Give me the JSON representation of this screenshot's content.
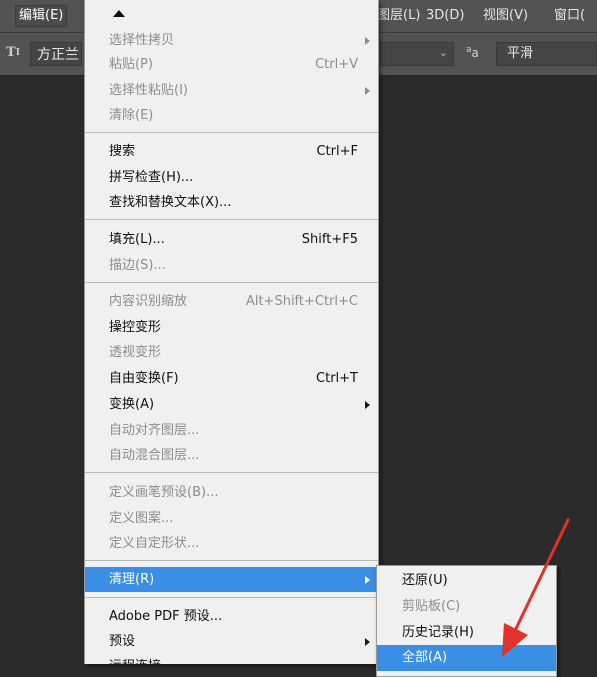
{
  "menubar": {
    "items": [
      {
        "label": "编辑(E)",
        "active": true
      },
      {
        "label": "图层(L)"
      },
      {
        "label": "3D(D)"
      },
      {
        "label": "视图(V)"
      },
      {
        "label": "窗口("
      }
    ]
  },
  "options_bar": {
    "tool_icon": "text-tool-icon",
    "font_family": "方正兰",
    "size_value": "",
    "antialias_icon": "aa-icon",
    "antialias_mode": "平滑"
  },
  "edit_menu": {
    "scroll_up_icon": "scroll-up-arrow-icon",
    "groups": [
      [
        {
          "label": "选择性拷贝",
          "shortcut": "",
          "disabled": true,
          "submenu": true
        },
        {
          "label": "粘贴(P)",
          "shortcut": "Ctrl+V",
          "disabled": true
        },
        {
          "label": "选择性粘贴(I)",
          "shortcut": "",
          "disabled": true,
          "submenu": true
        },
        {
          "label": "清除(E)",
          "shortcut": "",
          "disabled": true
        }
      ],
      [
        {
          "label": "搜索",
          "shortcut": "Ctrl+F"
        },
        {
          "label": "拼写检查(H)...",
          "shortcut": ""
        },
        {
          "label": "查找和替换文本(X)...",
          "shortcut": ""
        }
      ],
      [
        {
          "label": "填充(L)...",
          "shortcut": "Shift+F5"
        },
        {
          "label": "描边(S)...",
          "shortcut": "",
          "disabled": true
        }
      ],
      [
        {
          "label": "内容识别缩放",
          "shortcut": "Alt+Shift+Ctrl+C",
          "disabled": true
        },
        {
          "label": "操控变形",
          "shortcut": ""
        },
        {
          "label": "透视变形",
          "shortcut": "",
          "disabled": true
        },
        {
          "label": "自由变换(F)",
          "shortcut": "Ctrl+T"
        },
        {
          "label": "变换(A)",
          "shortcut": "",
          "submenu": true
        },
        {
          "label": "自动对齐图层...",
          "shortcut": "",
          "disabled": true
        },
        {
          "label": "自动混合图层...",
          "shortcut": "",
          "disabled": true
        }
      ],
      [
        {
          "label": "定义画笔预设(B)...",
          "shortcut": "",
          "disabled": true
        },
        {
          "label": "定义图案...",
          "shortcut": "",
          "disabled": true
        },
        {
          "label": "定义自定形状...",
          "shortcut": "",
          "disabled": true
        }
      ],
      [
        {
          "label": "清理(R)",
          "shortcut": "",
          "submenu": true,
          "highlight": true
        }
      ],
      [
        {
          "label": "Adobe PDF 预设...",
          "shortcut": ""
        },
        {
          "label": "预设",
          "shortcut": "",
          "submenu": true
        },
        {
          "label": "远程连接...",
          "shortcut": ""
        }
      ]
    ]
  },
  "purge_submenu": {
    "items": [
      {
        "label": "还原(U)"
      },
      {
        "label": "剪贴板(C)",
        "disabled": true
      },
      {
        "label": "历史记录(H)"
      },
      {
        "label": "全部(A)",
        "highlight": true
      }
    ]
  },
  "annotation": {
    "color": "#e0312a",
    "icon": "red-pointer-arrow-icon"
  },
  "colors": {
    "menu_bg": "#f0f0f0",
    "highlight": "#3a8ee6",
    "app_bg": "#2b2b2b",
    "bar_bg": "#535353"
  }
}
